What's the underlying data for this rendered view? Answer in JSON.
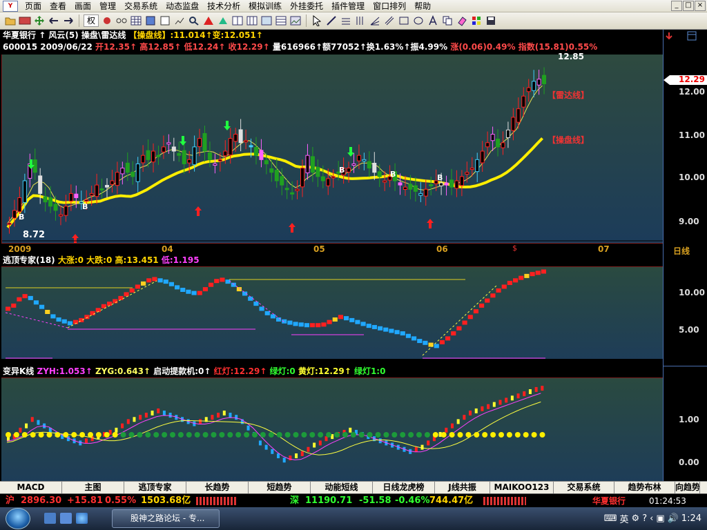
{
  "menubar": {
    "logo": "Y",
    "items": [
      "页面",
      "查看",
      "画面",
      "管理",
      "交易系统",
      "动态监盘",
      "技术分析",
      "模拟训练",
      "外挂委托",
      "插件管理",
      "窗口排列",
      "帮助"
    ],
    "window_buttons": [
      "_",
      "□",
      "×"
    ]
  },
  "toolbar": {
    "quan_label": "权"
  },
  "main_pane": {
    "title_prefix": "华夏银行",
    "title_mid": "↑ 风云(5) 操盘\\雷达线",
    "title_ind": "【操盘线】:11.014↑变:12.051↑",
    "info_code": "600015 2009/06/22",
    "info_open": "开12.35↑",
    "info_high": "高12.85↑",
    "info_low": "低12.24↑",
    "info_close": "收12.29↑",
    "info_vol": "量616966↑额77052↑换1.63%↑振4.99%",
    "info_chg": "涨(0.06)0.49%",
    "info_idx": "指数(15.81)0.55%",
    "price_labels": [
      "12.00",
      "11.00",
      "10.00",
      "9.00"
    ],
    "current_price": "12.29",
    "low_label": "8.72",
    "high_label": "12.85",
    "leida_label": "【雷达线】",
    "caopan_label": "【操盘线】",
    "b_label": "B",
    "x_marker": "$"
  },
  "time_axis": {
    "labels": [
      "2009",
      "04",
      "05",
      "06",
      "07"
    ],
    "period": "日线"
  },
  "pane2": {
    "title": "逃顶专家(18)",
    "stats": "大涨:0 大跌:0",
    "high": "高:13.451",
    "low": "低:1.195",
    "axis": [
      "10.00",
      "5.00"
    ]
  },
  "pane3": {
    "title": "变异K线",
    "zyh": "ZYH:1.053↑",
    "zyg": "ZYG:0.643↑",
    "qidong": "启动提款机:0↑",
    "red": "红灯:12.29↑",
    "green": "绿灯:0",
    "yellow": "黄灯:12.29↑",
    "green2": "绿灯1:0",
    "axis": [
      "1.00",
      "0.00"
    ]
  },
  "tabs": [
    "MACD",
    "主图",
    "逃顶专家",
    "长趋势",
    "短趋势",
    "动能短线",
    "日线龙虎榜",
    "J线共振",
    "MAIKOO123",
    "交易系统",
    "趋势布林",
    "向趋势"
  ],
  "indexbar": {
    "sh_label": "沪",
    "sh_value": "2896.30",
    "sh_change": "+15.81",
    "sh_pct": "0.55%",
    "sh_amount": "1503.68亿",
    "sz_label": "深",
    "sz_value": "11190.71",
    "sz_change": "-51.58",
    "sz_pct": "-0.46%",
    "sz_amount": "744.47亿",
    "stock": "华夏银行",
    "time": "01:24:53"
  },
  "taskbar": {
    "task_title": "股神之路论坛 - 专...",
    "ime": "英",
    "clock": "1:24"
  }
}
